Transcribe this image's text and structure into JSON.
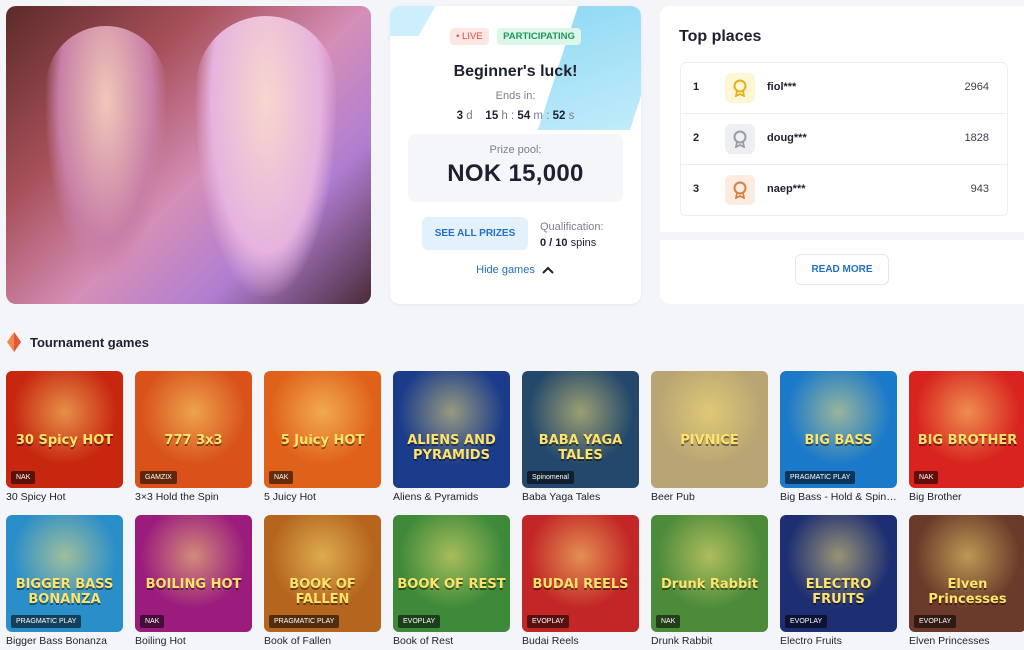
{
  "tournament": {
    "status_live": "• LIVE",
    "status_participating": "PARTICIPATING",
    "title": "Beginner's luck!",
    "ends_label": "Ends in:",
    "timer": {
      "d": "3",
      "d_unit": "d",
      "h": "15",
      "h_unit": "h",
      "m": "54",
      "m_unit": "m",
      "s": "52",
      "s_unit": "s"
    },
    "prize_label": "Prize pool:",
    "prize_value": "NOK 15,000",
    "see_all_prizes": "SEE ALL PRIZES",
    "qualification_label": "Qualification:",
    "qualification_progress": "0 / 10",
    "qualification_unit": "spins",
    "hide_games": "Hide games"
  },
  "top_places": {
    "title": "Top places",
    "rows": [
      {
        "rank": "1",
        "name": "fiol***",
        "score": "2964",
        "medal": "gold"
      },
      {
        "rank": "2",
        "name": "doug***",
        "score": "1828",
        "medal": "silver"
      },
      {
        "rank": "3",
        "name": "naep***",
        "score": "943",
        "medal": "bronze"
      }
    ],
    "read_more": "READ MORE"
  },
  "games_section": {
    "title": "Tournament games"
  },
  "games": [
    {
      "name": "30 Spicy Hot",
      "art": "30 Spicy HOT",
      "provider": "NAK",
      "bg": "#c7260f"
    },
    {
      "name": "3×3 Hold the Spin",
      "art": "777 3x3",
      "provider": "GAMZIX",
      "bg": "#d8521a"
    },
    {
      "name": "5 Juicy Hot",
      "art": "5 Juicy HOT",
      "provider": "NAK",
      "bg": "#e0621a"
    },
    {
      "name": "Aliens & Pyramids",
      "art": "ALIENS AND PYRAMIDS",
      "provider": "",
      "bg": "#1b3c8a"
    },
    {
      "name": "Baba Yaga Tales",
      "art": "BABA YAGA TALES",
      "provider": "Spinomenal",
      "bg": "#24486b"
    },
    {
      "name": "Beer Pub",
      "art": "PIVNICE",
      "provider": "",
      "bg": "#b9a574"
    },
    {
      "name": "Big Bass - Hold & Spinner",
      "art": "BIG BASS",
      "provider": "PRAGMATIC PLAY",
      "bg": "#1a79c9"
    },
    {
      "name": "Big Brother",
      "art": "BIG BROTHER",
      "provider": "NAK",
      "bg": "#d8231f"
    },
    {
      "name": "Bigger Bass Bonanza",
      "art": "BIGGER BASS BONANZA",
      "provider": "PRAGMATIC PLAY",
      "bg": "#2a8ec9"
    },
    {
      "name": "Boiling Hot",
      "art": "BOILING HOT",
      "provider": "NAK",
      "bg": "#9b1c7c"
    },
    {
      "name": "Book of Fallen",
      "art": "BOOK OF FALLEN",
      "provider": "PRAGMATIC PLAY",
      "bg": "#b5651d"
    },
    {
      "name": "Book of Rest",
      "art": "BOOK OF REST",
      "provider": "EVOPLAY",
      "bg": "#3e8a3a"
    },
    {
      "name": "Budai Reels",
      "art": "BUDAI REELS",
      "provider": "EVOPLAY",
      "bg": "#c22626"
    },
    {
      "name": "Drunk Rabbit",
      "art": "Drunk Rabbit",
      "provider": "NAK",
      "bg": "#4d8b3b"
    },
    {
      "name": "Electro Fruits",
      "art": "ELECTRO FRUITS",
      "provider": "EVOPLAY",
      "bg": "#1d2e72"
    },
    {
      "name": "Elven Princesses",
      "art": "Elven Princesses",
      "provider": "EVOPLAY",
      "bg": "#6a3a2a"
    }
  ]
}
